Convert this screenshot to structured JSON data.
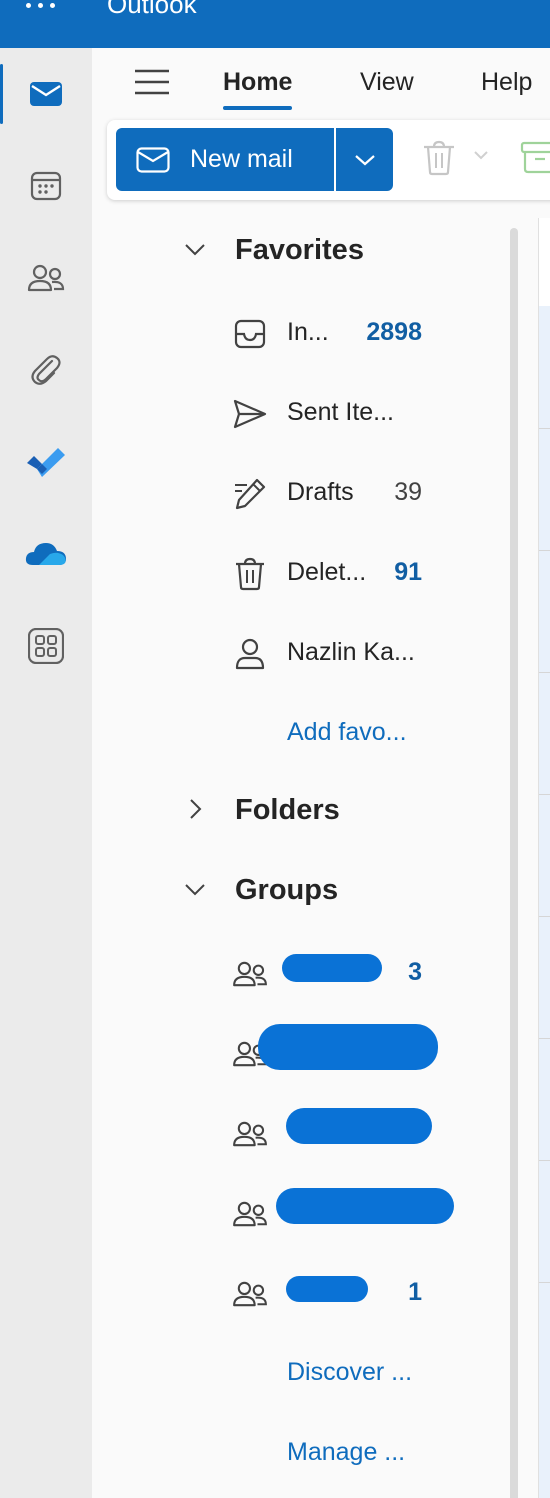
{
  "header": {
    "app_title": "Outlook",
    "waffle_icon": "waffle-icon",
    "brand_color": "#0f6cbd"
  },
  "rail": {
    "items": [
      {
        "icon": "mail-icon",
        "active": true
      },
      {
        "icon": "calendar-icon"
      },
      {
        "icon": "people-icon"
      },
      {
        "icon": "attachment-icon"
      },
      {
        "icon": "todo-icon"
      },
      {
        "icon": "onedrive-icon"
      },
      {
        "icon": "apps-icon"
      }
    ]
  },
  "tabs": {
    "home": "Home",
    "view": "View",
    "help": "Help"
  },
  "ribbon": {
    "new_mail_label": "New mail"
  },
  "favorites": {
    "title": "Favorites",
    "items": [
      {
        "name": "In...",
        "count": "2898",
        "icon": "inbox-icon"
      },
      {
        "name": "Sent Ite...",
        "count": "",
        "icon": "send-icon"
      },
      {
        "name": "Drafts",
        "count": "39",
        "icon": "drafts-icon"
      },
      {
        "name": "Delet...",
        "count": "91",
        "icon": "trash-icon"
      },
      {
        "name": "Nazlin Ka...",
        "count": "",
        "icon": "person-icon"
      }
    ],
    "add_favorite": "Add favo..."
  },
  "folders": {
    "title": "Folders"
  },
  "groups": {
    "title": "Groups",
    "items": [
      {
        "name": "",
        "count": "3",
        "icon": "group-icon"
      },
      {
        "name": "",
        "count": "",
        "icon": "group-icon"
      },
      {
        "name": "",
        "count": "",
        "icon": "group-icon"
      },
      {
        "name": "",
        "count": "",
        "icon": "group-icon"
      },
      {
        "name": "",
        "count": "1",
        "icon": "group-icon"
      }
    ],
    "discover": "Discover ...",
    "manage": "Manage ..."
  }
}
